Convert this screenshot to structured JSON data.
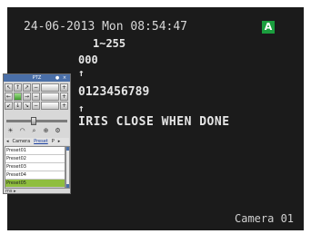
{
  "osd": {
    "datetime": "24-06-2013 Mon 08:54:47",
    "range": "1~255",
    "zero": "000",
    "arrow": "↑",
    "digits": "0123456789",
    "instruction": "IRIS CLOSE WHEN DONE",
    "camera_label": "Camera 01"
  },
  "indicator": {
    "label": "A",
    "color": "#1b9e3e"
  },
  "ptz": {
    "title": "PTZ",
    "tabs": [
      "Camera",
      "Preset",
      "P"
    ],
    "active_tab": "Preset",
    "presets": [
      "Preset01",
      "Preset02",
      "Preset03",
      "Preset04",
      "Preset05"
    ],
    "selected_preset": "Preset05",
    "more_label": "ms"
  }
}
